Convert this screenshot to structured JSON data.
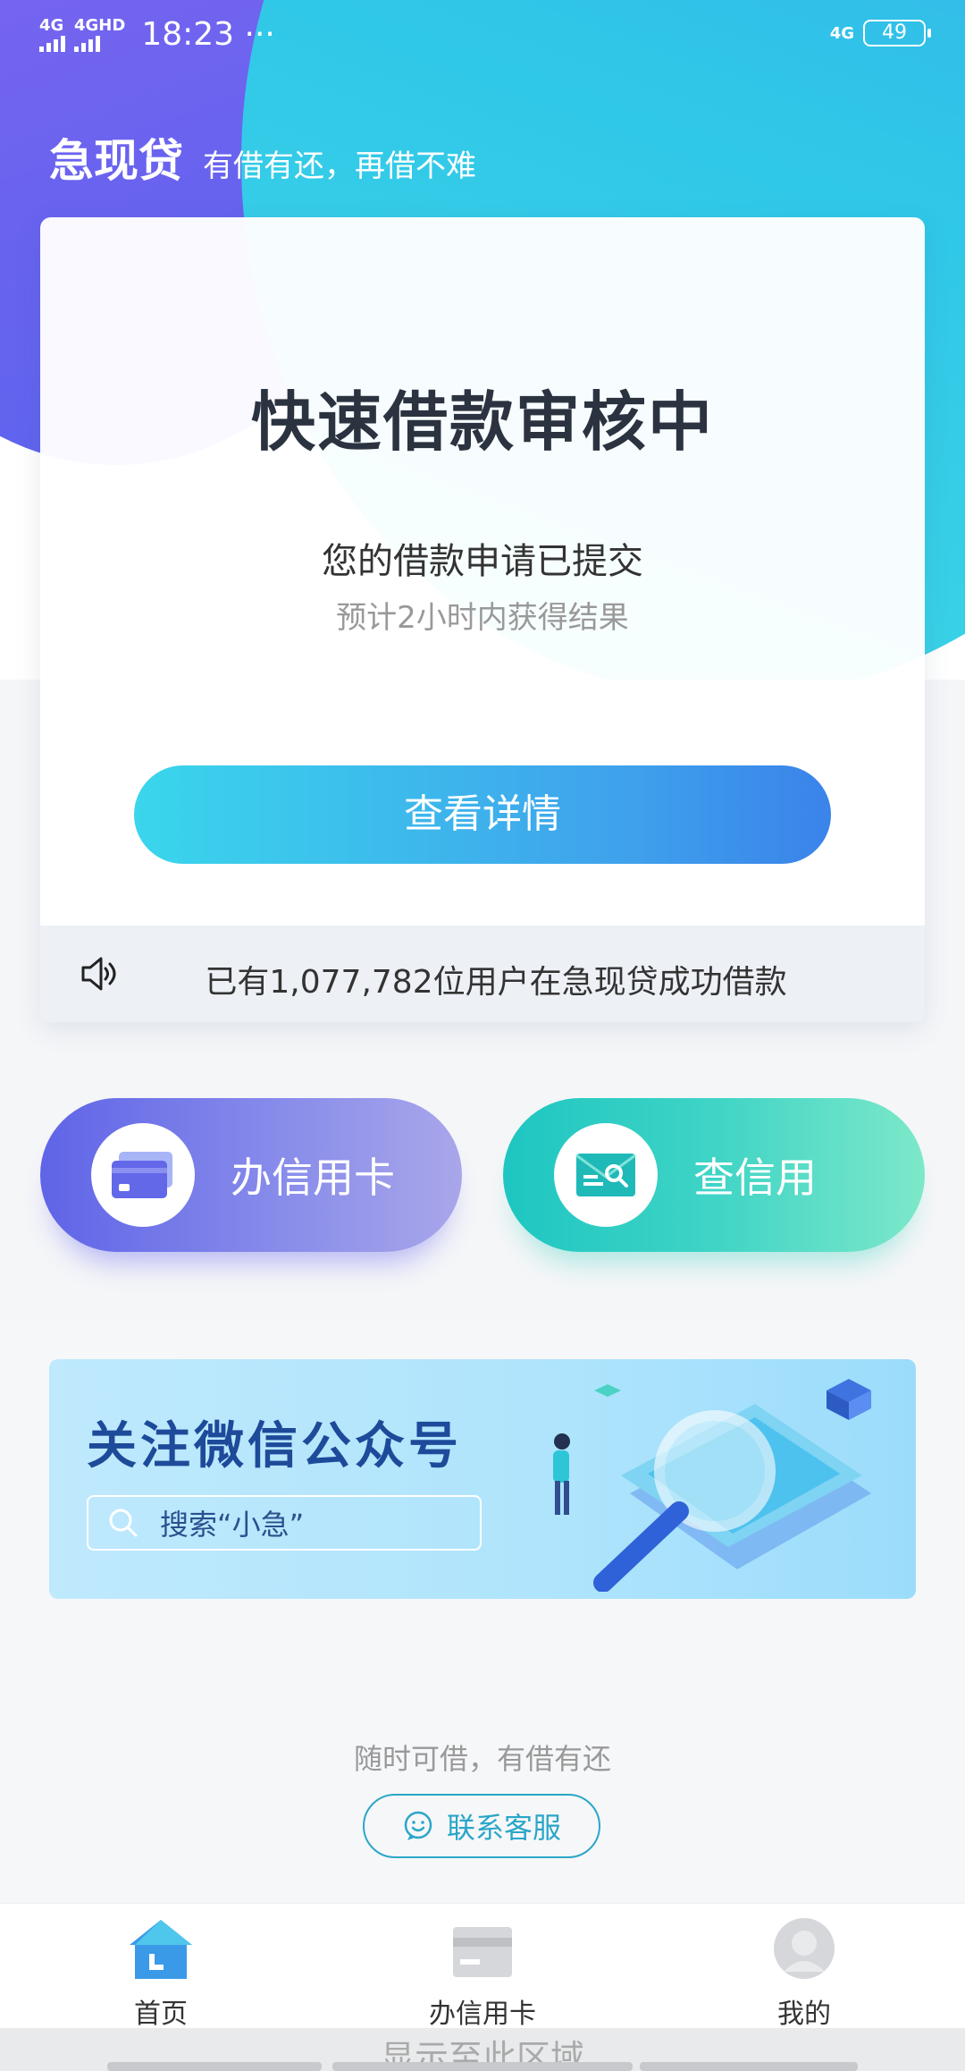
{
  "status_bar": {
    "signal1": "4G",
    "signal2": "4GHD",
    "time": "18:23 ···",
    "network": "4G",
    "battery": "49"
  },
  "header": {
    "title": "急现贷",
    "slogan": "有借有还，再借不难"
  },
  "loan_card": {
    "title": "快速借款审核中",
    "subtitle": "您的借款申请已提交",
    "note": "预计2小时内获得结果",
    "button_label": "查看详情",
    "notice_text": "已有1,077,782位用户在急现贷成功借款"
  },
  "actions": {
    "credit_card_label": "办信用卡",
    "check_credit_label": "查信用"
  },
  "banner": {
    "title": "关注微信公众号",
    "search_text": "搜索“小急”"
  },
  "footer": {
    "tagline": "随时可借，有借有还",
    "service_label": "联系客服"
  },
  "tabbar": {
    "items": [
      {
        "label": "首页",
        "icon": "home-icon"
      },
      {
        "label": "办信用卡",
        "icon": "credit-card-icon"
      },
      {
        "label": "我的",
        "icon": "user-icon"
      }
    ]
  },
  "bottom_hint": "显示至此区域",
  "colors": {
    "brand_blue": "#3a83ea",
    "brand_cyan": "#3ad6ec",
    "purple": "#6a63ef",
    "teal": "#1ec6c1",
    "service_blue": "#2aa6c8"
  }
}
